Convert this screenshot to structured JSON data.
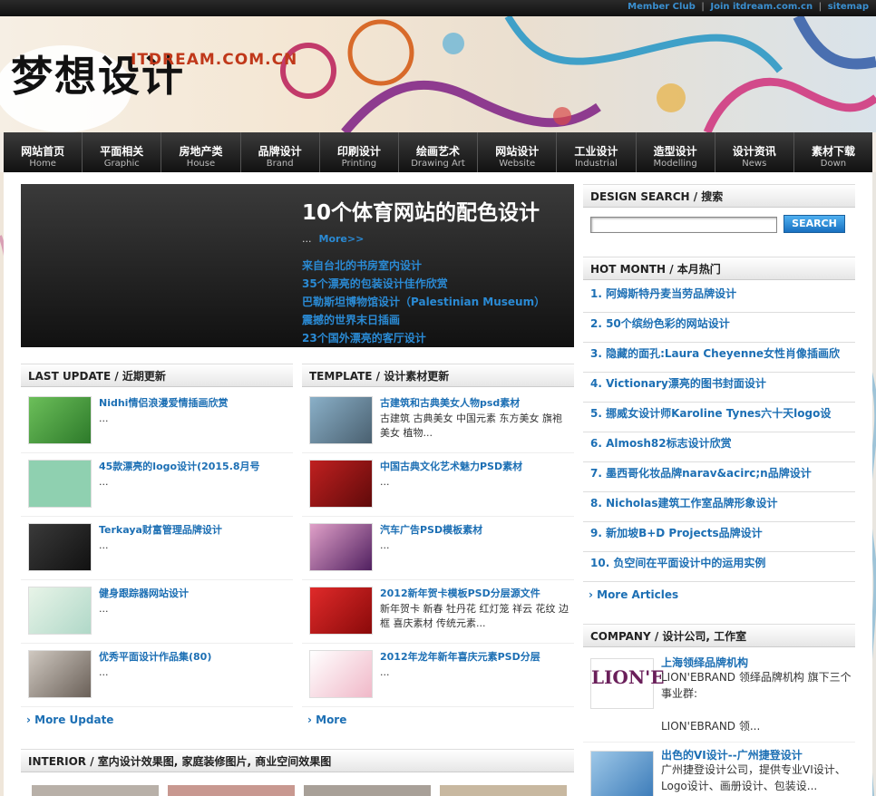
{
  "toplinks": {
    "member": "Member Club",
    "join": "Join itdream.com.cn",
    "sitemap": "sitemap",
    "sep": "|"
  },
  "logo": {
    "cn": "梦想设计",
    "en": "ITDREAM.COM.CN"
  },
  "nav": [
    {
      "cn": "网站首页",
      "en": "Home"
    },
    {
      "cn": "平面相关",
      "en": "Graphic"
    },
    {
      "cn": "房地产类",
      "en": "House"
    },
    {
      "cn": "品牌设计",
      "en": "Brand"
    },
    {
      "cn": "印刷设计",
      "en": "Printing"
    },
    {
      "cn": "绘画艺术",
      "en": "Drawing Art"
    },
    {
      "cn": "网站设计",
      "en": "Website"
    },
    {
      "cn": "工业设计",
      "en": "Industrial"
    },
    {
      "cn": "造型设计",
      "en": "Modelling"
    },
    {
      "cn": "设计资讯",
      "en": "News"
    },
    {
      "cn": "素材下载",
      "en": "Down"
    }
  ],
  "feature": {
    "title": "10个体育网站的配色设计",
    "ellipsis": "...",
    "more": "More>>",
    "links": [
      "来自台北的书房室内设计",
      "35个漂亮的包装设计佳作欣赏",
      "巴勒斯坦博物馆设计（Palestinian Museum）",
      "震撼的世界末日插画",
      "23个国外漂亮的客厅设计"
    ]
  },
  "last_update": {
    "head": "LAST UPDATE / 近期更新",
    "items": [
      {
        "title": "Nidhi情侣浪漫爱情插画欣赏",
        "desc": "..."
      },
      {
        "title": "45款漂亮的logo设计(2015.8月号",
        "desc": "..."
      },
      {
        "title": "Terkaya财富管理品牌设计",
        "desc": "..."
      },
      {
        "title": "健身跟踪器网站设计",
        "desc": "..."
      },
      {
        "title": "优秀平面设计作品集(80)",
        "desc": "..."
      }
    ],
    "more": "› More Update"
  },
  "template": {
    "head": "TEMPLATE / 设计素材更新",
    "items": [
      {
        "title": "古建筑和古典美女人物psd素材",
        "desc": "古建筑 古典美女 中国元素 东方美女 旗袍美女 植物..."
      },
      {
        "title": "中国古典文化艺术魅力PSD素材",
        "desc": "..."
      },
      {
        "title": "汽车广告PSD模板素材",
        "desc": "..."
      },
      {
        "title": "2012新年贺卡模板PSD分层源文件",
        "desc": "新年贺卡 新春 牡丹花 红灯笼 祥云 花纹 边框 喜庆素材 传统元素..."
      },
      {
        "title": "2012年龙年新年喜庆元素PSD分层",
        "desc": "..."
      }
    ],
    "more": "› More"
  },
  "interior": {
    "head": "INTERIOR / 室内设计效果图, 家庭装修图片, 商业空间效果图"
  },
  "search": {
    "head": "DESIGN SEARCH / 搜索",
    "button": "SEARCH",
    "placeholder": ""
  },
  "hot": {
    "head": "HOT MONTH / 本月热门",
    "items": [
      "1. 阿姆斯特丹麦当劳品牌设计",
      "2. 50个缤纷色彩的网站设计",
      "3. 隐藏的面孔:Laura Cheyenne女性肖像插画欣",
      "4. Victionary漂亮的图书封面设计",
      "5. 挪威女设计师Karoline Tynes六十天logo设",
      "6. Almosh82标志设计欣赏",
      "7. 墨西哥化妆品牌narav&acirc;n品牌设计",
      "8. Nicholas建筑工作室品牌形象设计",
      "9. 新加坡B+D Projects品牌设计",
      "10. 负空间在平面设计中的运用实例"
    ],
    "more": "› More Articles"
  },
  "company": {
    "head": "COMPANY / 设计公司, 工作室",
    "items": [
      {
        "title": "上海领绎品牌机构",
        "desc": "LION'EBRAND 领绎品牌机构 旗下三个事业群:",
        "desc2": "LION'EBRAND 领...",
        "logo": "LION'E"
      },
      {
        "title": "出色的VI设计--广州捷登设计",
        "desc": "广州捷登设计公司，提供专业VI设计、Logo设计、画册设计、包装设..."
      }
    ]
  }
}
